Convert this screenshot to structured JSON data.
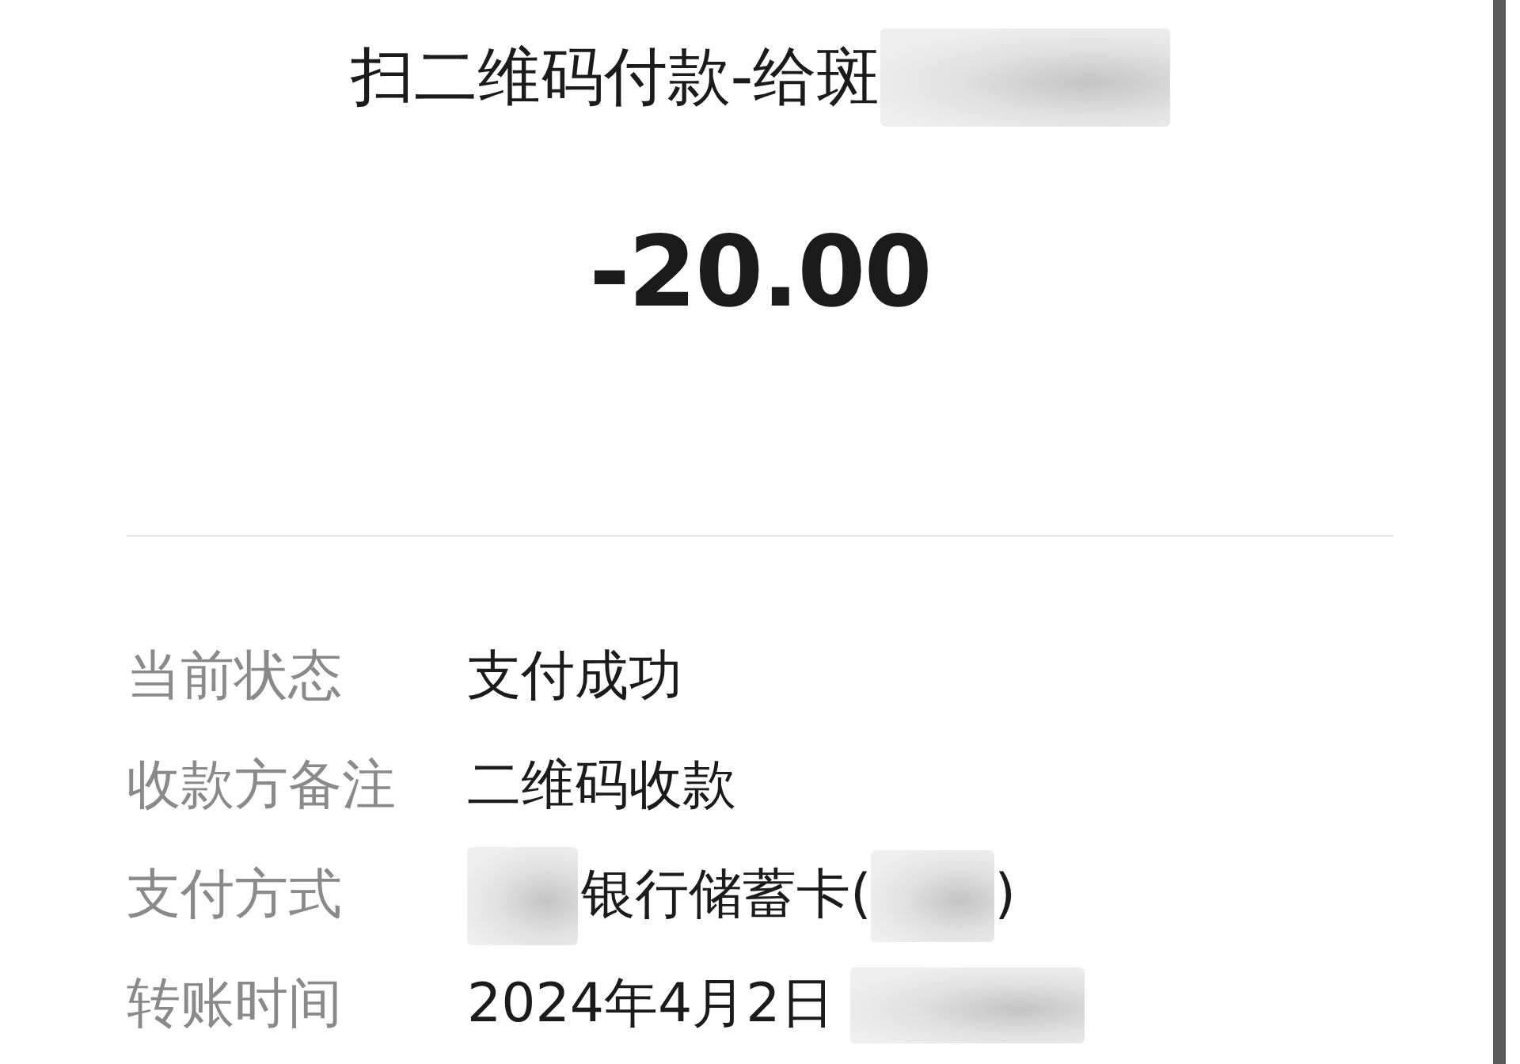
{
  "header": {
    "title": [
      {
        "kind": "text",
        "text": "扫二维码付款-给斑"
      },
      {
        "kind": "redacted"
      }
    ],
    "amount": "-20.00"
  },
  "details": [
    {
      "label": "当前状态",
      "value": [
        {
          "kind": "text",
          "text": "支付成功"
        }
      ]
    },
    {
      "label": "收款方备注",
      "value": [
        {
          "kind": "text",
          "text": "二维码收款"
        }
      ]
    },
    {
      "label": "支付方式",
      "value": [
        {
          "kind": "redacted"
        },
        {
          "kind": "text",
          "text": "银行储蓄卡("
        },
        {
          "kind": "redacted"
        },
        {
          "kind": "text",
          "text": ")"
        }
      ]
    },
    {
      "label": "转账时间",
      "value": [
        {
          "kind": "text",
          "text": "2024年4月2日"
        },
        {
          "kind": "redacted"
        }
      ]
    }
  ]
}
